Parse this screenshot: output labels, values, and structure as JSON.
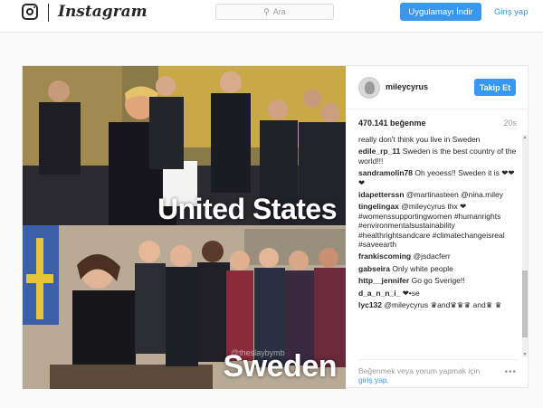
{
  "topbar": {
    "wordmark": "Instagram",
    "search_placeholder": "Ara",
    "install_label": "Uygulamayı İndir",
    "login_label": "Giriş yap"
  },
  "post": {
    "photo": {
      "caption_top": "United States",
      "caption_bottom": "Sweden",
      "watermark": "@theslaybymb"
    },
    "username": "mileycyrus",
    "follow_label": "Takip Et",
    "likes": "470.141 beğenme",
    "time": "20s",
    "comments": [
      {
        "user": "",
        "text": "really don't think you live in Sweden"
      },
      {
        "user": "edile_rp_11",
        "text": "Sweden is the best country of the world!!!"
      },
      {
        "user": "sandramolin78",
        "text": "Oh yeoess!! Sweden it is ❤❤❤"
      },
      {
        "user": "idapetterssn",
        "text": "@martinasteen @nina.miley"
      },
      {
        "user": "tingelingax",
        "text": "@mileycyrus thx ❤ #womenssupportingwomen #humanrights #environmentalsustainability #healthrightsandcare #climatechangeisreal #saveearth"
      },
      {
        "user": "frankiscoming",
        "text": "@jsdacferr"
      },
      {
        "user": "gabseira",
        "text": "Only white people"
      },
      {
        "user": "http__jennifer",
        "text": "Go go Sverige!!"
      },
      {
        "user": "d_a_n_n_i_",
        "text": "❤•se"
      },
      {
        "user": "lyc132",
        "text": "@mileycyrus ♛and♛♛♛ and♛ ♛"
      }
    ],
    "login_prompt_text": "Beğenmek veya yorum yapmak için",
    "login_prompt_link": "giriş yap.",
    "more_icon": "•••"
  }
}
